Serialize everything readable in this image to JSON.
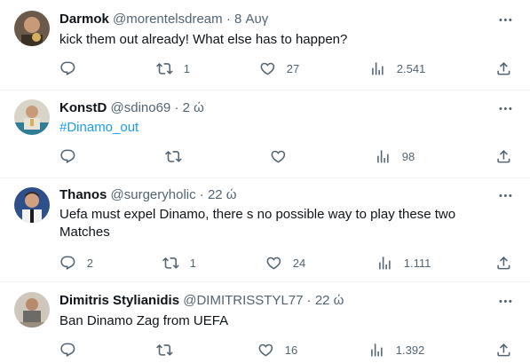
{
  "tweets": [
    {
      "name": "Darmok",
      "handle": "@morentelsdream",
      "dot": "·",
      "time": "8 Αυγ",
      "text": "kick them out already! What else has to happen?",
      "replies": "",
      "retweets": "1",
      "likes": "27",
      "views": "2.541"
    },
    {
      "name": "KonstD",
      "handle": "@sdino69",
      "dot": "·",
      "time": "2 ώ",
      "text": "#Dinamo_out",
      "replies": "",
      "retweets": "",
      "likes": "",
      "views": "98"
    },
    {
      "name": "Thanos",
      "handle": "@surgeryholic",
      "dot": "·",
      "time": "22 ώ",
      "text": "Uefa must expel Dinamo, there s no possible way to play these two Matches",
      "replies": "2",
      "retweets": "1",
      "likes": "24",
      "views": "1.111"
    },
    {
      "name": "Dimitris Stylianidis",
      "handle": "@DIMITRISSTYL77",
      "dot": "·",
      "time": "22 ώ",
      "text": "Ban Dinamo Zag from UEFA",
      "replies": "",
      "retweets": "",
      "likes": "16",
      "views": "1.392"
    }
  ],
  "colors": {
    "text": "#0f1419",
    "secondary": "#536471",
    "link": "#1d9bf0",
    "divider": "#eff3f4"
  },
  "icons": {
    "reply": "reply-icon",
    "retweet": "retweet-icon",
    "like": "like-icon",
    "views": "views-icon",
    "share": "share-icon",
    "more": "more-icon"
  }
}
